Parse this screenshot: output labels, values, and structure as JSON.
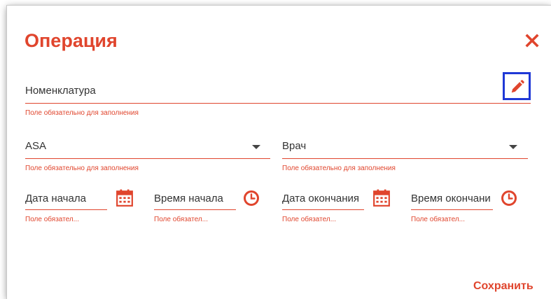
{
  "dialog": {
    "title": "Операция",
    "close_icon": "close-icon",
    "save_label": "Сохранить"
  },
  "colors": {
    "accent": "#e0452d",
    "focus_border": "#1f38d6",
    "text": "#333333"
  },
  "fields": {
    "nomenclature": {
      "value": "Номенклатура",
      "error": "Поле обязательно для заполнения",
      "action_icon": "pencil-icon"
    },
    "asa": {
      "value": "ASA",
      "error": "Поле обязательно для заполнения",
      "action_icon": "chevron-down-icon"
    },
    "doctor": {
      "value": "Врач",
      "error": "Поле обязательно для заполнения",
      "action_icon": "chevron-down-icon"
    },
    "start_date": {
      "value": "Дата начала",
      "error": "Поле обязател...",
      "action_icon": "calendar-icon"
    },
    "start_time": {
      "value": "Время начала",
      "error": "Поле обязател...",
      "action_icon": "clock-icon"
    },
    "end_date": {
      "value": "Дата окончания",
      "error": "Поле обязател...",
      "action_icon": "calendar-icon"
    },
    "end_time": {
      "value": "Время окончания",
      "error": "Поле обязател...",
      "action_icon": "clock-icon"
    }
  }
}
